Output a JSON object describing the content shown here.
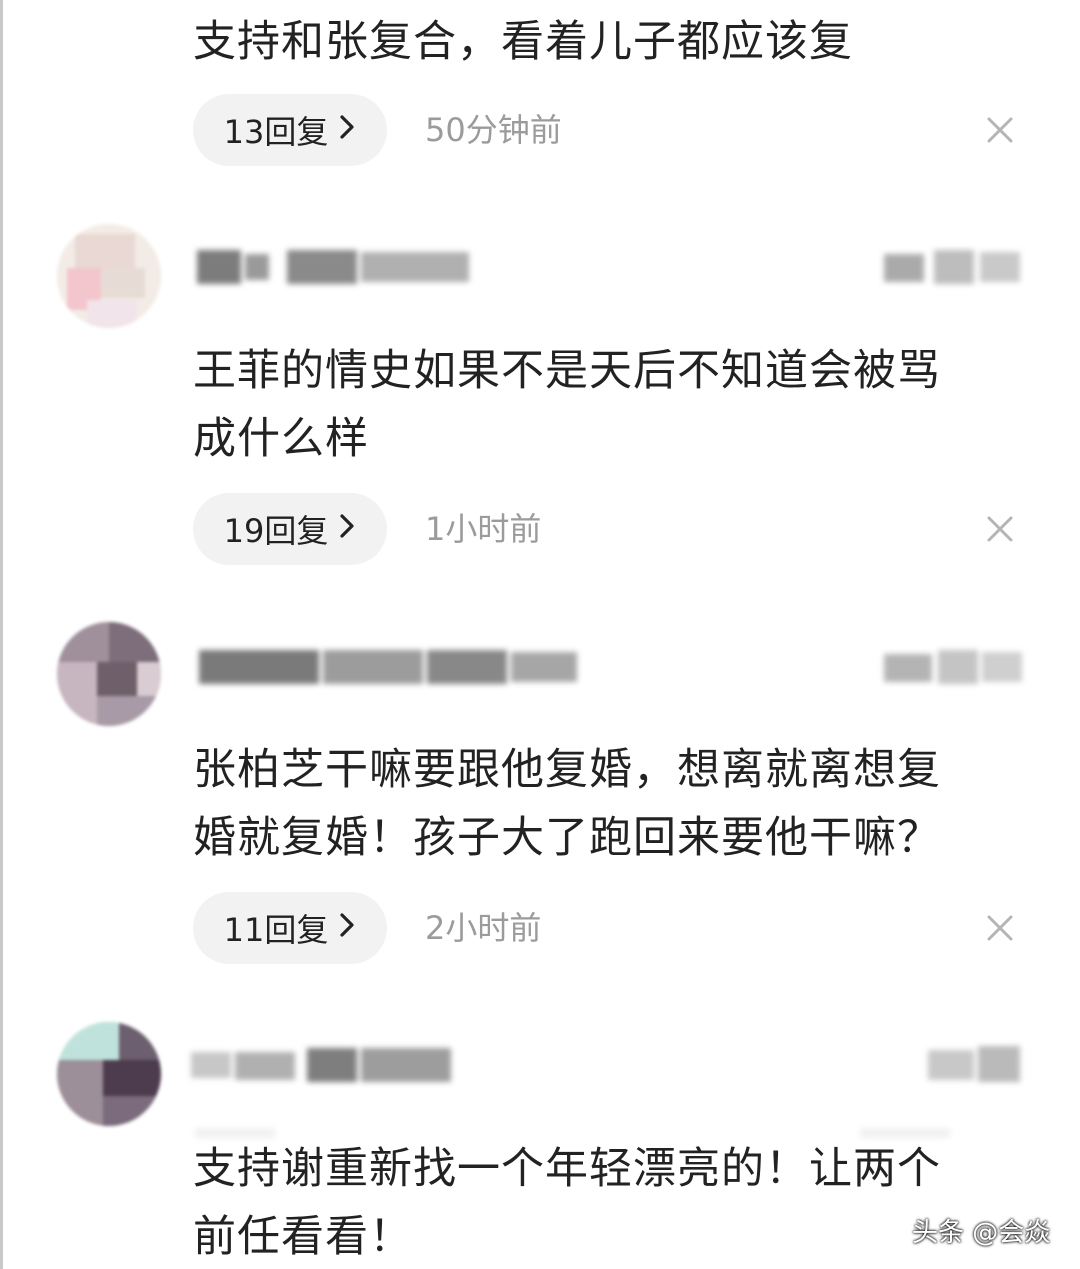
{
  "comments": [
    {
      "text": "支持和张复合，看着儿子都应该复",
      "reply_label": "13回复",
      "time": "50分钟前"
    },
    {
      "text_line1": "王菲的情史如果不是天后不知道会被骂",
      "text_line2": "成什么样",
      "reply_label": "19回复",
      "time": "1小时前"
    },
    {
      "text_line1": "张柏芝干嘛要跟他复婚，想离就离想复",
      "text_line2": "婚就复婚！孩子大了跑回来要他干嘛？",
      "reply_label": "11回复",
      "time": "2小时前"
    },
    {
      "text_line1": "支持谢重新找一个年轻漂亮的！让两个",
      "text_line2": "前任看看！"
    }
  ],
  "icons": {
    "chevron": "chevron-right-icon",
    "close": "close-icon"
  },
  "watermark": "头条 @会焱",
  "colors": {
    "text": "#222222",
    "muted": "#9b9b9b",
    "pill": "#f2f2f2"
  }
}
